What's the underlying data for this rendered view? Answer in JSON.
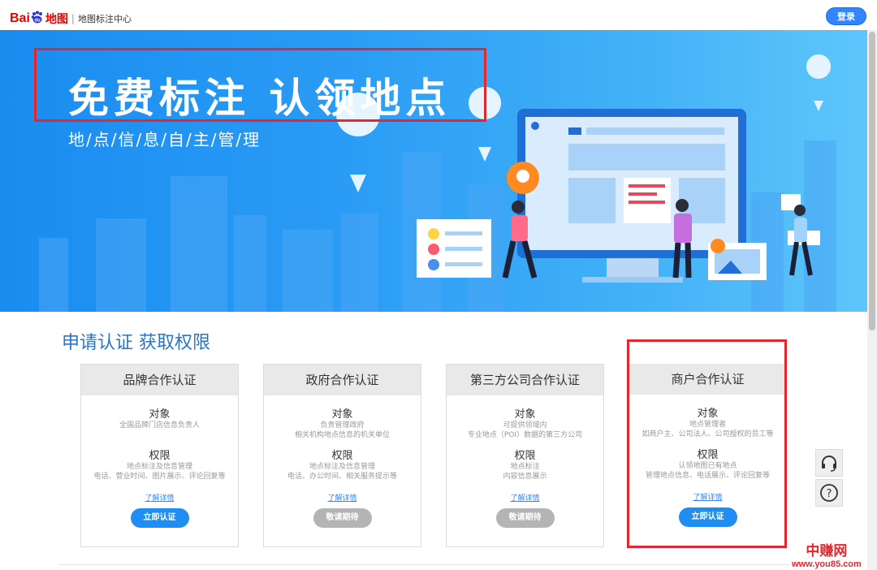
{
  "header": {
    "logo_bai": "Bai",
    "logo_du": "du",
    "logo_map": "地图",
    "logo_separator": "|",
    "subtitle": "地图标注中心",
    "login_label": "登录"
  },
  "banner": {
    "title": "免费标注  认领地点",
    "subtitle": "地/点/信/息/自/主/管/理"
  },
  "section": {
    "title": "申请认证 获取权限"
  },
  "cards": [
    {
      "title": "品牌合作认证",
      "target_heading": "对象",
      "target_lines": [
        "全国品牌门店信息负责人"
      ],
      "perm_heading": "权限",
      "perm_lines": [
        "地点标注及信息管理",
        "电话、营业时间、图片展示、评论回复等"
      ],
      "link": "了解详情",
      "button": "立即认证",
      "button_state": "active"
    },
    {
      "title": "政府合作认证",
      "target_heading": "对象",
      "target_lines": [
        "负责管理政府",
        "相关机构地点信息的机关单位"
      ],
      "perm_heading": "权限",
      "perm_lines": [
        "地点标注及信息管理",
        "电话、办公时间、相关服务提示等"
      ],
      "link": "了解详情",
      "button": "敬请期待",
      "button_state": "disabled"
    },
    {
      "title": "第三方公司合作认证",
      "target_heading": "对象",
      "target_lines": [
        "可提供领域内",
        "专业地点（POI）数据的第三方公司"
      ],
      "perm_heading": "权限",
      "perm_lines": [
        "地点标注",
        "内容信息展示"
      ],
      "link": "了解详情",
      "button": "敬请期待",
      "button_state": "disabled"
    },
    {
      "title": "商户合作认证",
      "target_heading": "对象",
      "target_lines": [
        "地点管理者",
        "如商户主、公司法人、公司授权的员工等"
      ],
      "perm_heading": "权限",
      "perm_lines": [
        "认领地图已有地点",
        "管理地点信息、电话展示、评论回复等"
      ],
      "link": "了解详情",
      "button": "立即认证",
      "button_state": "active"
    }
  ],
  "side_tools": {
    "support_icon": "headset-icon",
    "help_icon": "question-icon"
  },
  "watermark": {
    "line1": "中赚网",
    "line2": "www.you85.com"
  },
  "colors": {
    "brand_red": "#e10601",
    "accent_blue": "#1f8df2",
    "highlight_red": "#e8252b",
    "disabled_gray": "#b4b4b4"
  }
}
